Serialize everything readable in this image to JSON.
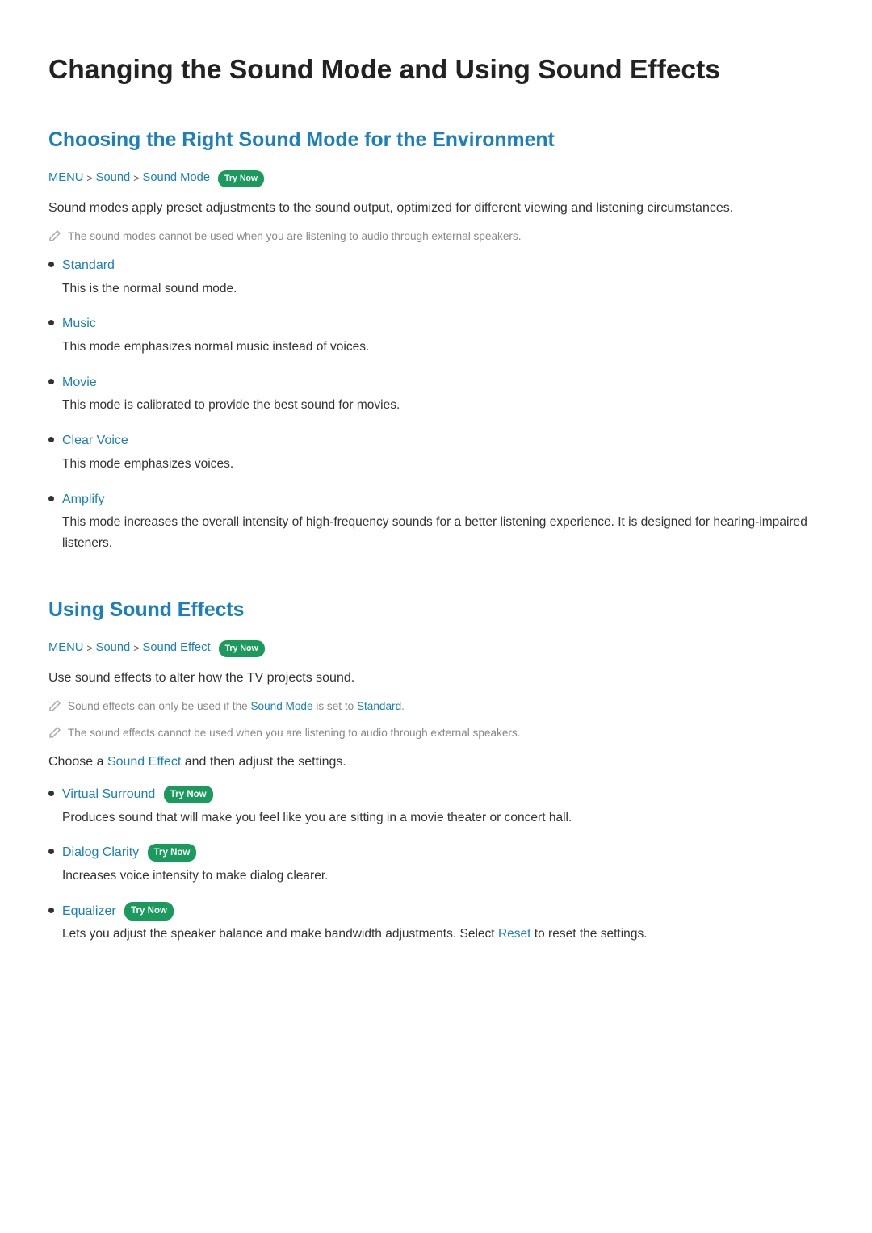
{
  "page": {
    "title": "Changing the Sound Mode and Using Sound Effects"
  },
  "section1": {
    "title": "Choosing the Right Sound Mode for the Environment",
    "breadcrumb": {
      "items": [
        "MENU",
        "Sound",
        "Sound Mode"
      ],
      "separators": [
        ">",
        ">"
      ],
      "badge": "Try Now"
    },
    "intro": "Sound modes apply preset adjustments to the sound output, optimized for different viewing and listening circumstances.",
    "note": "The sound modes cannot be used when you are listening to audio through external speakers.",
    "modes": [
      {
        "label": "Standard",
        "desc": "This is the normal sound mode."
      },
      {
        "label": "Music",
        "desc": "This mode emphasizes normal music instead of voices."
      },
      {
        "label": "Movie",
        "desc": "This mode is calibrated to provide the best sound for movies."
      },
      {
        "label": "Clear Voice",
        "desc": "This mode emphasizes voices."
      },
      {
        "label": "Amplify",
        "desc": "This mode increases the overall intensity of high-frequency sounds for a better listening experience. It is designed for hearing-impaired listeners."
      }
    ]
  },
  "section2": {
    "title": "Using Sound Effects",
    "breadcrumb": {
      "items": [
        "MENU",
        "Sound",
        "Sound Effect"
      ],
      "separators": [
        ">",
        ">"
      ],
      "badge": "Try Now"
    },
    "intro": "Use sound effects to alter how the TV projects sound.",
    "notes": [
      {
        "text_prefix": "Sound effects can only be used if the ",
        "link1": "Sound Mode",
        "text_middle": " is set to ",
        "link2": "Standard",
        "text_suffix": "."
      },
      {
        "text": "The sound effects cannot be used when you are listening to audio through external speakers."
      }
    ],
    "choose_text_prefix": "Choose a ",
    "choose_link": "Sound Effect",
    "choose_text_suffix": " and then adjust the settings.",
    "effects": [
      {
        "label": "Virtual Surround",
        "badge": "Try Now",
        "desc": "Produces sound that will make you feel like you are sitting in a movie theater or concert hall."
      },
      {
        "label": "Dialog Clarity",
        "badge": "Try Now",
        "desc": "Increases voice intensity to make dialog clearer."
      },
      {
        "label": "Equalizer",
        "badge": "Try Now",
        "desc_prefix": "Lets you adjust the speaker balance and make bandwidth adjustments. Select ",
        "desc_link": "Reset",
        "desc_suffix": " to reset the settings."
      }
    ]
  },
  "colors": {
    "accent": "#1a7fba",
    "badge_bg": "#1a9a5c",
    "badge_text": "#ffffff",
    "note_text": "#888888",
    "body_text": "#333333"
  }
}
